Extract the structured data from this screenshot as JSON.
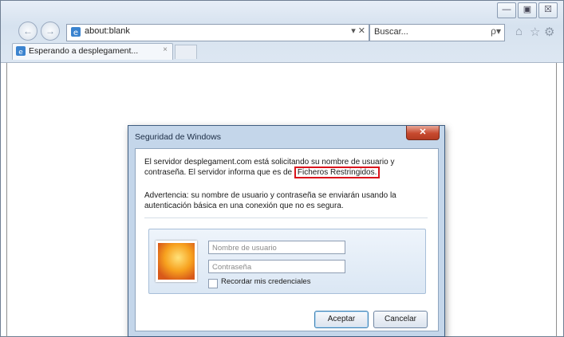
{
  "window": {
    "minimize_glyph": "—",
    "maximize_glyph": "▣",
    "close_glyph": "☒"
  },
  "toolbar": {
    "back_glyph": "←",
    "forward_glyph": "→",
    "address": "about:blank",
    "address_controls": "▾ ✕",
    "search_placeholder": "Buscar...",
    "search_glyph": "ρ▾",
    "icons": [
      "home-icon",
      "star-icon",
      "gear-icon"
    ]
  },
  "tabs": [
    {
      "label": "Esperando a desplegament...",
      "close_glyph": "×"
    }
  ],
  "dialog": {
    "title": "Seguridad de Windows",
    "close_glyph": "✕",
    "message_part1": "El servidor desplegament.com está solicitando su nombre de usuario y contraseña. El servidor informa que es de ",
    "message_highlight": "Ficheros Restringidos.",
    "warning": "Advertencia: su nombre de usuario y contraseña se enviarán usando la autenticación básica en una conexión que no es segura.",
    "username_placeholder": "Nombre de usuario",
    "password_placeholder": "Contraseña",
    "remember_label": "Recordar mis credenciales",
    "ok_label": "Aceptar",
    "cancel_label": "Cancelar"
  },
  "colors": {
    "highlight_border": "#d9141c",
    "dialog_frame": "#c4d6ea"
  }
}
